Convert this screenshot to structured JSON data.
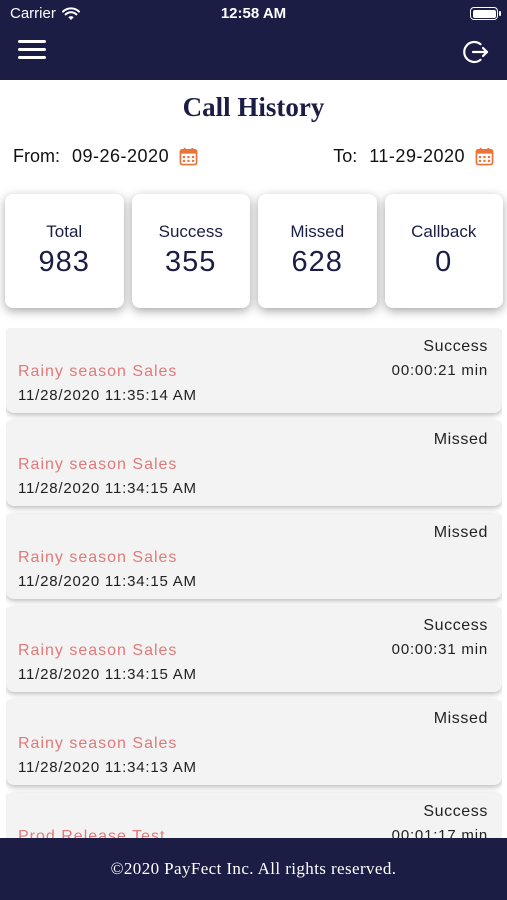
{
  "status_bar": {
    "carrier": "Carrier",
    "time": "12:58 AM"
  },
  "header": {
    "menu_icon": "hamburger-menu-icon",
    "logout_icon": "logout-icon"
  },
  "page": {
    "title": "Call History"
  },
  "filters": {
    "from_label": "From:",
    "from_value": "09-26-2020",
    "to_label": "To:",
    "to_value": "11-29-2020",
    "calendar_icon": "calendar-icon"
  },
  "stats": [
    {
      "label": "Total",
      "value": "983"
    },
    {
      "label": "Success",
      "value": "355"
    },
    {
      "label": "Missed",
      "value": "628"
    },
    {
      "label": "Callback",
      "value": "0"
    }
  ],
  "calls": [
    {
      "status": "Success",
      "duration": "00:00:21 min",
      "name": "Rainy season Sales",
      "time": "11/28/2020 11:35:14 AM"
    },
    {
      "status": "Missed",
      "duration": "",
      "name": "Rainy season Sales",
      "time": "11/28/2020 11:34:15 AM"
    },
    {
      "status": "Missed",
      "duration": "",
      "name": "Rainy season Sales",
      "time": "11/28/2020 11:34:15 AM"
    },
    {
      "status": "Success",
      "duration": "00:00:31 min",
      "name": "Rainy season Sales",
      "time": "11/28/2020 11:34:15 AM"
    },
    {
      "status": "Missed",
      "duration": "",
      "name": "Rainy season Sales",
      "time": "11/28/2020 11:34:13 AM"
    },
    {
      "status": "Success",
      "duration": "00:01:17 min",
      "name": "Prod Release Test",
      "time": ""
    }
  ],
  "footer": {
    "text": "©2020 PayFect Inc. All rights reserved."
  },
  "colors": {
    "navy": "#1b1d45",
    "accent_orange": "#e8743b",
    "call_name": "#e07a7a"
  }
}
